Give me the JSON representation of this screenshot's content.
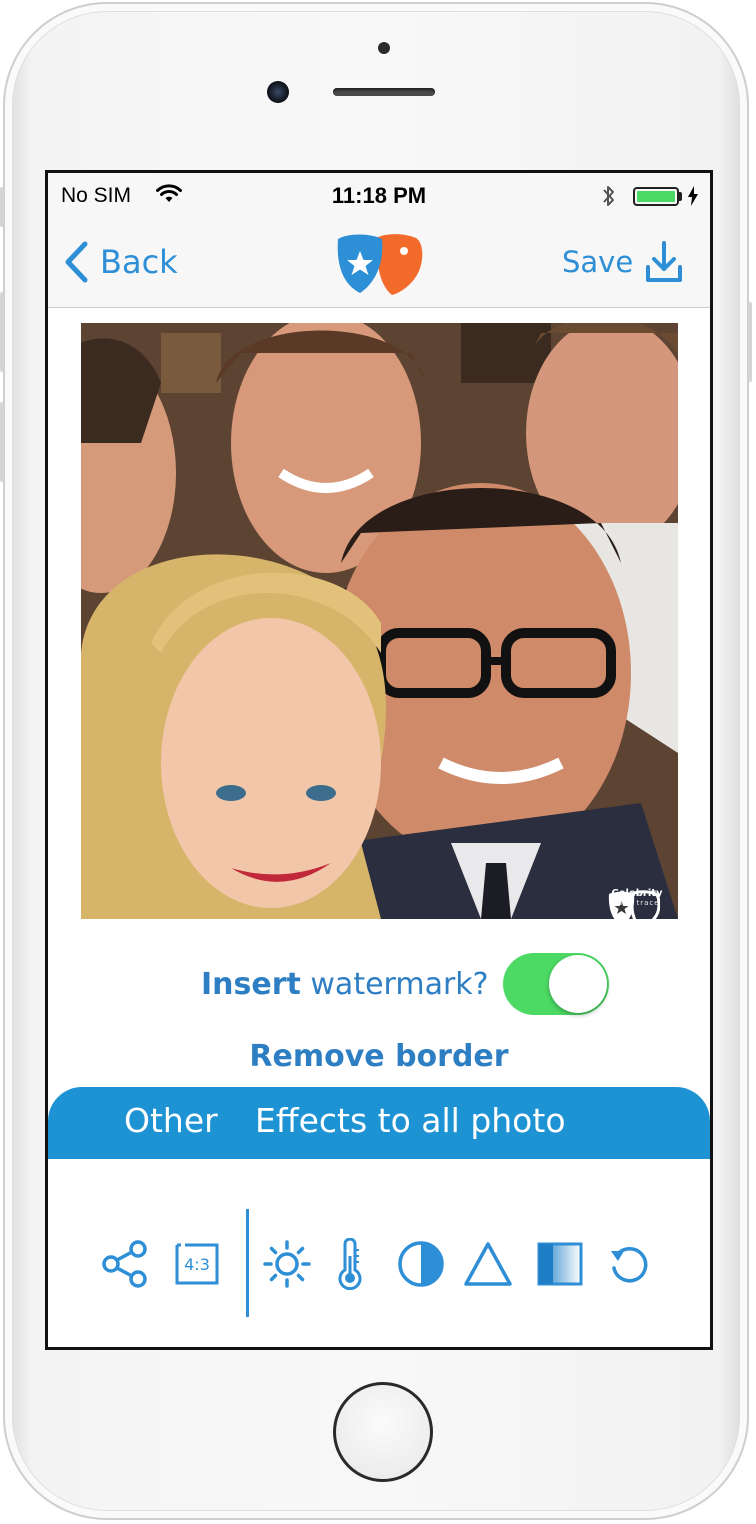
{
  "status_bar": {
    "carrier": "No SIM",
    "time": "11:18 PM"
  },
  "nav": {
    "back_label": "Back",
    "save_label": "Save"
  },
  "photo": {
    "watermark_name": "Celebrity",
    "watermark_sub": "face trace"
  },
  "watermark_toggle": {
    "label_bold": "Insert",
    "label_rest": " watermark?",
    "enabled": true
  },
  "remove_border_label": "Remove border",
  "tabs": {
    "other": "Other",
    "effects": "Effects to all photo"
  },
  "toolbar": {
    "ratio_label": "4:3",
    "icons": [
      "share-icon",
      "aspect-ratio-icon",
      "brightness-icon",
      "temperature-icon",
      "contrast-icon",
      "sharpen-icon",
      "vignette-icon",
      "reset-icon"
    ]
  },
  "colors": {
    "accent": "#2e8fd6",
    "tab_background": "#1e93d4",
    "toggle_on": "#4cd964",
    "logo_blue": "#2d8fd5",
    "logo_orange": "#f26b2a"
  }
}
